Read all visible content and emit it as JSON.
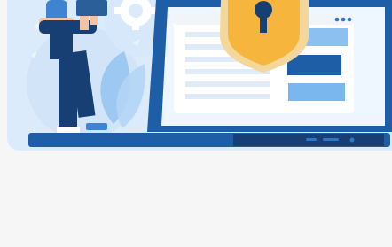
{
  "hero": {
    "alt": "",
    "icons": [
      "person-icon",
      "gear-icon",
      "laptop-icon",
      "shield-lock-icon",
      "browser-window-icon",
      "leaf-icon"
    ],
    "colors": {
      "background": "#f6f6f6",
      "card": "#dcebfb",
      "laptop": "#1d5ea7",
      "laptop_dark": "#173f73",
      "screen": "#eef6ff",
      "shield": "#f6b63d",
      "shield_border": "#f4d79a",
      "accent": "#3f84d1"
    }
  }
}
